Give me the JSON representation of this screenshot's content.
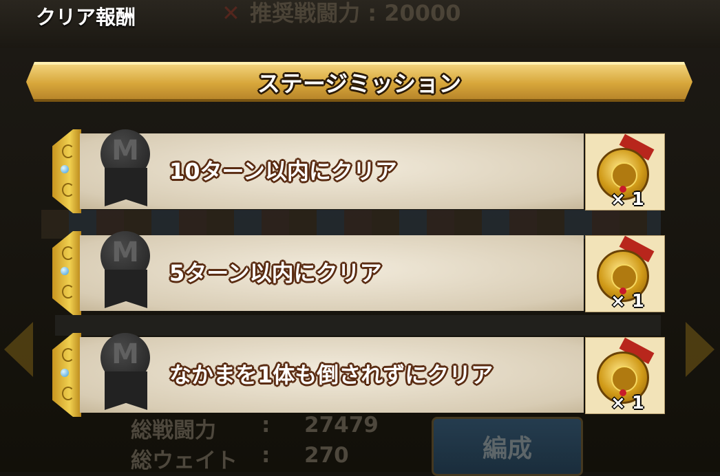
{
  "header": {
    "title": "クリア報酬",
    "recommended_power_label": "推奨戦闘力",
    "recommended_power_value": "20000"
  },
  "banner": {
    "title": "ステージミッション"
  },
  "missions": [
    {
      "text": "10ターン以内にクリア",
      "reward_count": "× 1"
    },
    {
      "text": "5ターン以内にクリア",
      "reward_count": "× 1"
    },
    {
      "text": "なかまを1体も倒されずにクリア",
      "reward_count": "× 1"
    }
  ],
  "footer": {
    "total_power_label": "総戦闘力",
    "total_power_value": "27479",
    "total_weight_label": "総ウェイト",
    "total_weight_value": "270",
    "colon": ":",
    "formation_button": "編成"
  },
  "icons": {
    "mission_badge": "medal-m-icon",
    "reward": "gold-medal-icon",
    "nav": "arrow-icon"
  }
}
